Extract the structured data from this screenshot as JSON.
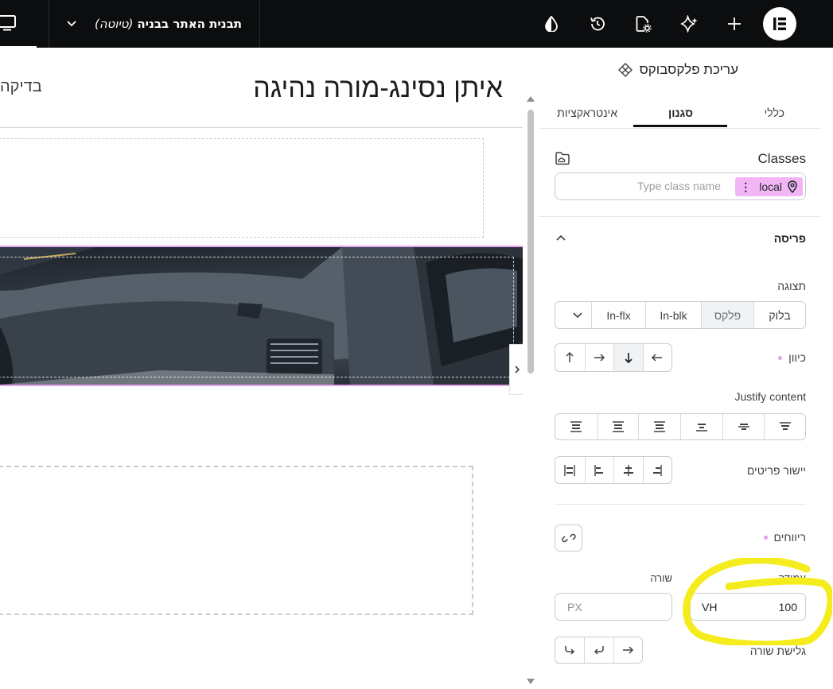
{
  "topbar": {
    "page_title": "תבנית האתר בבניה",
    "page_status": "(טיוטה)",
    "icons": [
      "desktop-icon",
      "chevron-down-icon",
      "contrast-icon",
      "history-icon",
      "page-settings-icon",
      "ai-sparkle-icon",
      "add-icon",
      "elementor-logo"
    ]
  },
  "canvas": {
    "heading": "איתן נסינג-מורה נהיגה",
    "side_text": "בדיקה"
  },
  "panel": {
    "title": "עריכת פלקסבוקס",
    "tabs": [
      "כללי",
      "סגנון",
      "אינטראקציות"
    ],
    "active_tab": "סגנון",
    "classes": {
      "label": "Classes",
      "chip": "local",
      "placeholder": "Type class name"
    },
    "layout": {
      "section_title": "פריסה",
      "display_label": "תצוגה",
      "display_options": [
        "בלוק",
        "פלקס",
        "In-blk",
        "In-flx"
      ],
      "display_selected": "פלקס",
      "direction_label": "כיוון",
      "justify_label": "Justify content",
      "align_label": "יישור פריטים",
      "gaps_label": "ריווחים",
      "column_label": "עמודה",
      "row_label": "שורה",
      "column_value": "100",
      "column_unit": "VH",
      "row_unit": "PX",
      "wrap_label": "גלישת שורה"
    }
  },
  "colors": {
    "topbar_bg": "#0c0d0e",
    "accent_pink": "#f2b6f6",
    "highlight_yellow": "#f4ec1c"
  }
}
